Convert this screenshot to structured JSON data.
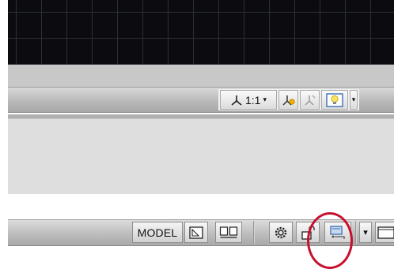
{
  "canvas": {
    "background": "#0c0c10",
    "grid_color": "#2a2f38"
  },
  "statusbar_top": {
    "annotation_scale_label": "1:1",
    "scale_dropdown_arrow": "▾",
    "buttons": [
      "annotation-visibility-icon",
      "auto-scale-icon",
      "lightbulb-icon"
    ]
  },
  "statusbar_bottom": {
    "model_label": "MODEL",
    "icons": [
      "layout1-icon",
      "layout2-icon",
      "settings-gear-icon",
      "lock-toolbar-icon",
      "hardware-acceleration-icon",
      "dropdown-arrow-icon",
      "clean-screen-icon"
    ],
    "dropdown_arrow": "▾"
  },
  "annotation": {
    "circle_color": "#c8102e"
  }
}
